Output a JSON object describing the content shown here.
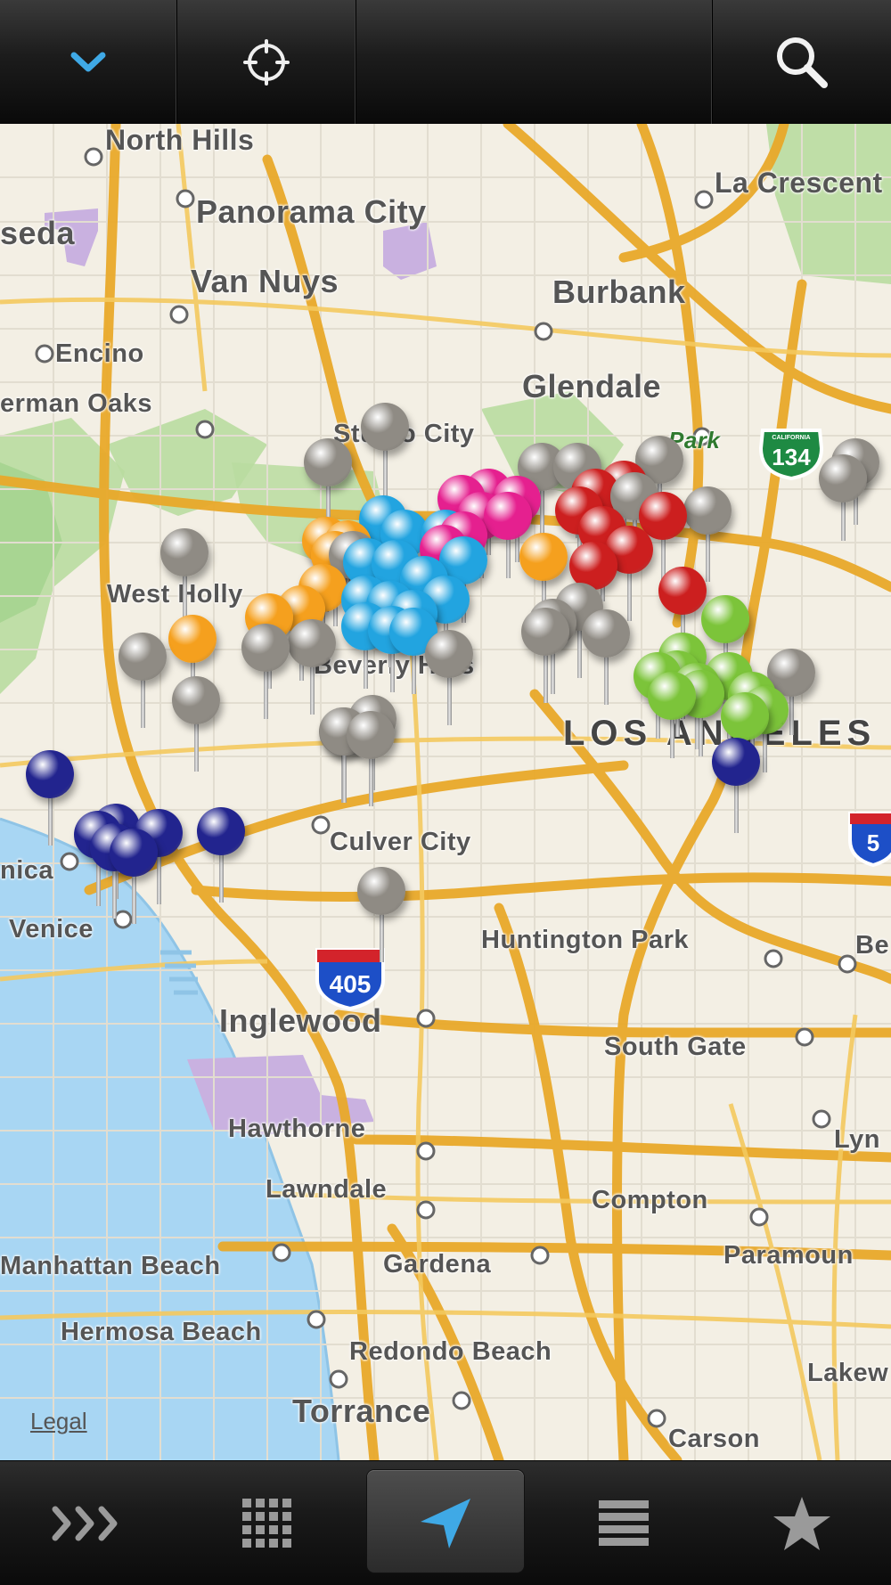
{
  "toolbar": {
    "collapse_icon": "chevron-down-icon",
    "locate_icon": "crosshair-icon",
    "search_icon": "search-icon",
    "accent": "#3fa9e6"
  },
  "map": {
    "places": {
      "north_hills": "North Hills",
      "la_crescenta": "La Crescent",
      "panorama_city": "Panorama City",
      "reseda": "seda",
      "van_nuys": "Van Nuys",
      "burbank": "Burbank",
      "encino": "Encino",
      "glendale": "Glendale",
      "sherman_oaks": "erman Oaks",
      "studio_city": "Studio City",
      "park": "Park",
      "west_hollywood": "West Holly",
      "beverly_hills": "Beverly Hills",
      "los_angeles": "LOS ANGELES",
      "culver_city": "Culver City",
      "santa_monica": "nica",
      "venice": "Venice",
      "huntington_park": "Huntington Park",
      "bell": "Be",
      "inglewood": "Inglewood",
      "south_gate": "South Gate",
      "hawthorne": "Hawthorne",
      "lynwood": "Lyn",
      "lawndale": "Lawndale",
      "compton": "Compton",
      "manhattan_beach": "Manhattan Beach",
      "gardena": "Gardena",
      "paramount": "Paramoun",
      "hermosa_beach": "Hermosa Beach",
      "redondo_beach": "Redondo Beach",
      "lakewood": "Lakew",
      "torrance": "Torrance",
      "carson": "Carson"
    },
    "highways": {
      "i405": "405",
      "ca134": "134",
      "ca134_top": "CALIFORNIA",
      "i5": "5"
    },
    "legal": "Legal",
    "pin_colors": {
      "gray": "#8f8b84",
      "orange": "#f5a01e",
      "blue": "#22a4e0",
      "magenta": "#e5208f",
      "red": "#cc1f1f",
      "green": "#7cc43a",
      "navy": "#22248e"
    }
  },
  "bottombar": {
    "tabs": [
      {
        "name": "forward-icon",
        "active": false
      },
      {
        "name": "grid-icon",
        "active": false
      },
      {
        "name": "navigate-arrow-icon",
        "active": true
      },
      {
        "name": "list-icon",
        "active": false
      },
      {
        "name": "star-icon",
        "active": false
      }
    ]
  }
}
